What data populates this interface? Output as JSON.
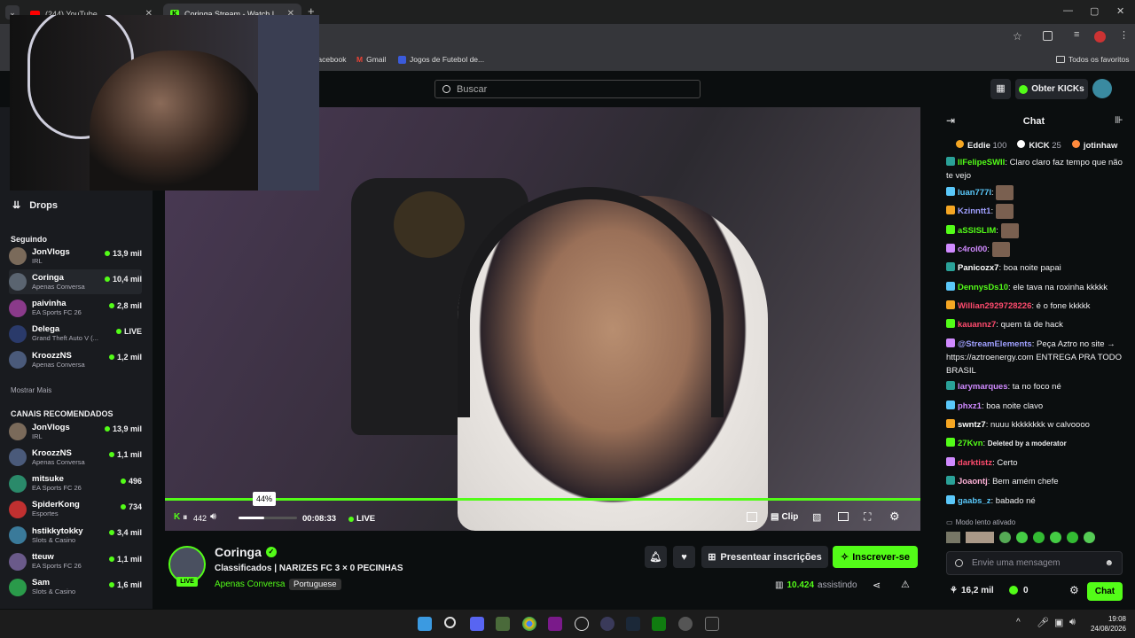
{
  "browser": {
    "tabs": [
      {
        "label": "(244) YouTube"
      },
      {
        "label": "Coringa Stream - Watch Li"
      }
    ],
    "bookmarks": [
      {
        "label": "facebook"
      },
      {
        "label": "Gmail"
      },
      {
        "label": "Jogos de Futebol de..."
      },
      {
        "label": "Todos os favoritos"
      }
    ]
  },
  "topnav": {
    "search_placeholder": "Buscar",
    "get_kicks": "Obter KICKs"
  },
  "sidebar": {
    "drops_label": "Drops",
    "following_title": "Seguindo",
    "following": [
      {
        "name": "JonVlogs",
        "category": "IRL",
        "viewers": "13,9 mil",
        "color": "#7a6a5a"
      },
      {
        "name": "Coringa",
        "category": "Apenas Conversa",
        "viewers": "10,4 mil",
        "color": "#5a6470"
      },
      {
        "name": "paivinha",
        "category": "EA Sports FC 26",
        "viewers": "2,8 mil",
        "color": "#8a3a8a"
      },
      {
        "name": "Delega",
        "category": "Grand Theft Auto V (...",
        "viewers": "LIVE",
        "color": "#2a3a6a"
      },
      {
        "name": "KroozzNS",
        "category": "Apenas Conversa",
        "viewers": "1,2 mil",
        "color": "#4a5a7a"
      }
    ],
    "show_more": "Mostrar Mais",
    "recommended_title": "CANAIS RECOMENDADOS",
    "recommended": [
      {
        "name": "JonVlogs",
        "category": "IRL",
        "viewers": "13,9 mil",
        "color": "#7a6a5a"
      },
      {
        "name": "KroozzNS",
        "category": "Apenas Conversa",
        "viewers": "1,1 mil",
        "color": "#4a5a7a"
      },
      {
        "name": "mitsuke",
        "category": "EA Sports FC 26",
        "viewers": "496",
        "color": "#2a8a6a"
      },
      {
        "name": "SpiderKong",
        "category": "Esportes",
        "viewers": "734",
        "color": "#c03030"
      },
      {
        "name": "hstikkytokky",
        "category": "Slots & Casino",
        "viewers": "3,4 mil",
        "color": "#3a7a9a"
      },
      {
        "name": "tteuw",
        "category": "EA Sports FC 26",
        "viewers": "1,1 mil",
        "color": "#6a5a8a"
      },
      {
        "name": "Sam",
        "category": "Slots & Casino",
        "viewers": "1,6 mil",
        "color": "#2a9a4a"
      }
    ]
  },
  "player": {
    "volume_tooltip": "44%",
    "volume_level": 0.44,
    "elapsed": "00:08:33",
    "live_label": "LIVE",
    "clip_label": "Clip",
    "skip_label": "442"
  },
  "stream": {
    "channel": "Coringa",
    "title": "Classificados | NARIZES FC 3 × 0 PECINHAS",
    "category": "Apenas Conversa",
    "language": "Portuguese",
    "live_badge": "LIVE",
    "gift_subs": "Presentear inscrições",
    "subscribe": "Inscrever-se",
    "viewers": "10.424",
    "viewers_label": "assistindo"
  },
  "chat": {
    "title": "Chat",
    "leaderboard": [
      {
        "name": "Eddie",
        "value": "100"
      },
      {
        "name": "KICK",
        "value": "25"
      },
      {
        "name": "jotinhaw",
        "value": ""
      }
    ],
    "messages": [
      {
        "user": "IlFelipeSWII",
        "color": "#53fc18",
        "text": "Claro claro faz tempo que não te vejo"
      },
      {
        "user": "luan777l",
        "color": "#5ac8fa",
        "text": ""
      },
      {
        "user": "Kzinntt1",
        "color": "#a0a0ff",
        "text": ""
      },
      {
        "user": "aSSISLIM",
        "color": "#53fc18",
        "text": ""
      },
      {
        "user": "c4rol00",
        "color": "#d08aff",
        "text": ""
      },
      {
        "user": "Panicozx7",
        "color": "#ffffff",
        "text": "boa noite papai"
      },
      {
        "user": "DennysDs10",
        "color": "#53fc18",
        "text": "ele tava na roxinha kkkkk"
      },
      {
        "user": "Willian2929728226",
        "color": "#ff4b6e",
        "text": "é o fone kkkkk"
      },
      {
        "user": "kauannz7",
        "color": "#ff4b6e",
        "text": "quem tá de hack"
      },
      {
        "user": "@StreamElements",
        "color": "#a0a0ff",
        "text": "Peça Aztro no site → https://aztroenergy.com ENTREGA PRA TODO BRASIL"
      },
      {
        "user": "larymarques",
        "color": "#d08aff",
        "text": "ta no foco né"
      },
      {
        "user": "phxz1",
        "color": "#d08aff",
        "text": "boa noite clavo"
      },
      {
        "user": "swntz7",
        "color": "#ffffff",
        "text": "nuuu kkkkkkkk w calvoooo"
      },
      {
        "user": "27Kvn",
        "color": "#53fc18",
        "text": "Deleted by a moderator"
      },
      {
        "user": "darktistz",
        "color": "#ff4b6e",
        "text": "Certo"
      },
      {
        "user": "Joaontj",
        "color": "#ffb3d9",
        "text": "Bem amém chefe"
      },
      {
        "user": "gaabs_z",
        "color": "#5ac8fa",
        "text": "babado né"
      }
    ],
    "slow_mode": "Modo lento ativado",
    "input_placeholder": "Envie uma mensagem",
    "likes": "16,2 mil",
    "kicks": "0",
    "send": "Chat"
  },
  "taskbar": {
    "time": "19:08",
    "date": "24/08/2026"
  },
  "colors": {
    "accent": "#53fc18",
    "bg": "#0b0e0f",
    "panel": "#191b1f"
  }
}
